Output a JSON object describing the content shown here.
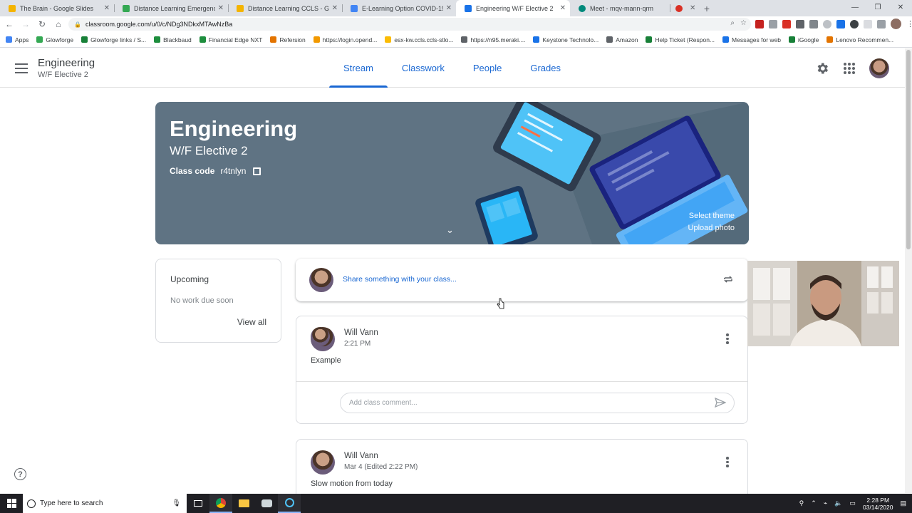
{
  "browser": {
    "tabs": [
      {
        "title": "The Brain - Google Slides",
        "color": "#f4b400"
      },
      {
        "title": "Distance Learning Emergency - G",
        "color": "#34a853"
      },
      {
        "title": "Distance Learning CCLS - Google",
        "color": "#f4b400"
      },
      {
        "title": "E-Learning Option COVID-19 - G",
        "color": "#4285f4"
      },
      {
        "title": "Engineering W/F Elective 2",
        "color": "#1a73e8",
        "active": true
      },
      {
        "title": "Meet - mqv-mann-qrm",
        "color": "#00897b"
      }
    ],
    "url": "classroom.google.com/u/0/c/NDg3NDkxMTAwNzBa",
    "bookmarks": [
      {
        "label": "Apps",
        "color": "#4285f4"
      },
      {
        "label": "Glowforge",
        "color": "#34a853"
      },
      {
        "label": "Glowforge links / S...",
        "color": "#188038"
      },
      {
        "label": "Blackbaud",
        "color": "#1e8e3e"
      },
      {
        "label": "Financial Edge NXT",
        "color": "#1e8e3e"
      },
      {
        "label": "Refersion",
        "color": "#e37400"
      },
      {
        "label": "https://login.opend...",
        "color": "#f29900"
      },
      {
        "label": "esx-kw.ccls.ccls-stlo...",
        "color": "#fbbc04"
      },
      {
        "label": "https://n95.meraki....",
        "color": "#5f6368"
      },
      {
        "label": "Keystone Technolo...",
        "color": "#1a73e8"
      },
      {
        "label": "Amazon",
        "color": "#5f6368"
      },
      {
        "label": "Help Ticket (Respon...",
        "color": "#188038"
      },
      {
        "label": "Messages for web",
        "color": "#1a73e8"
      },
      {
        "label": "iGoogle",
        "color": "#188038"
      },
      {
        "label": "Lenovo Recommen...",
        "color": "#e37400"
      }
    ]
  },
  "classroom": {
    "title": "Engineering",
    "subtitle": "W/F Elective 2",
    "tabs": [
      "Stream",
      "Classwork",
      "People",
      "Grades"
    ],
    "banner": {
      "title": "Engineering",
      "subtitle": "W/F Elective 2",
      "code_label": "Class code",
      "code": "r4tnlyn",
      "select_theme": "Select theme",
      "upload_photo": "Upload photo"
    },
    "upcoming": {
      "title": "Upcoming",
      "empty": "No work due soon",
      "view_all": "View all"
    },
    "share_placeholder": "Share something with your class...",
    "posts": [
      {
        "author": "Will Vann",
        "time": "2:21 PM",
        "body": "Example",
        "comment_placeholder": "Add class comment..."
      },
      {
        "author": "Will Vann",
        "time": "Mar 4 (Edited 2:22 PM)",
        "body": "Slow motion from today"
      }
    ]
  },
  "taskbar": {
    "search_placeholder": "Type here to search",
    "time": "2:28 PM",
    "date": "03/14/2020"
  },
  "colors": {
    "accent": "#1967d2",
    "banner": "#5f7383"
  }
}
